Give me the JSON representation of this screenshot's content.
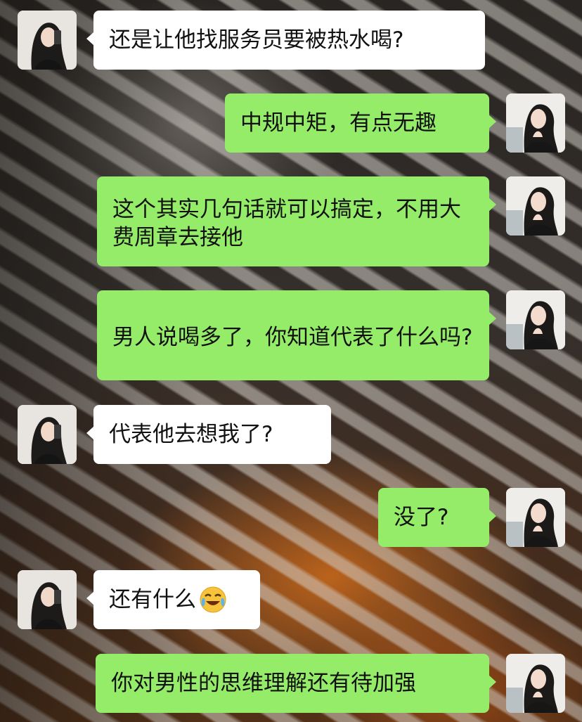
{
  "chat": {
    "messages": [
      {
        "sender": "other",
        "text": "还是让他找服务员要被热水喝?"
      },
      {
        "sender": "self",
        "text": "中规中矩，有点无趣"
      },
      {
        "sender": "self",
        "text": "这个其实几句话就可以搞定，不用大费周章去接他"
      },
      {
        "sender": "self",
        "text": "男人说喝多了，你知道代表了什么吗?"
      },
      {
        "sender": "other",
        "text": "代表他去想我了?"
      },
      {
        "sender": "self",
        "text": "没了?"
      },
      {
        "sender": "other",
        "text": "还有什么",
        "emoji": "face-with-tears-of-joy-crying-icon"
      },
      {
        "sender": "self",
        "text": "你对男性的思维理解还有待加强"
      }
    ]
  },
  "colors": {
    "self_bubble": "#95ec69",
    "other_bubble": "#ffffff"
  }
}
